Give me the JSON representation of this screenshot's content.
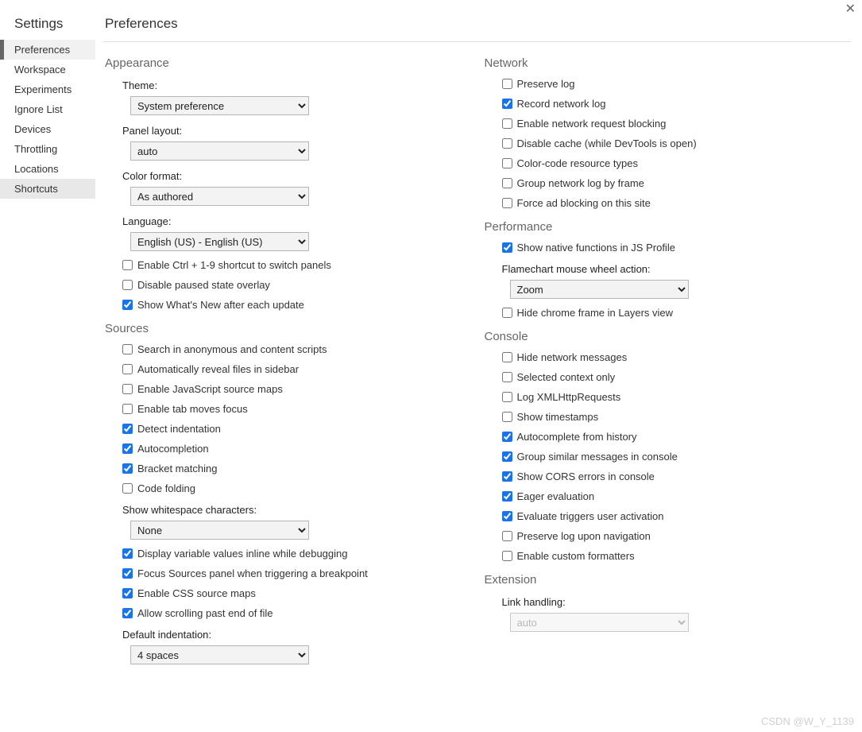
{
  "sidebar": {
    "title": "Settings",
    "items": [
      {
        "label": "Preferences",
        "active": true
      },
      {
        "label": "Workspace"
      },
      {
        "label": "Experiments"
      },
      {
        "label": "Ignore List"
      },
      {
        "label": "Devices"
      },
      {
        "label": "Throttling"
      },
      {
        "label": "Locations"
      },
      {
        "label": "Shortcuts",
        "hover": true
      }
    ]
  },
  "main": {
    "title": "Preferences",
    "close": "✕"
  },
  "appearance": {
    "heading": "Appearance",
    "theme_label": "Theme:",
    "theme_value": "System preference",
    "panel_label": "Panel layout:",
    "panel_value": "auto",
    "color_label": "Color format:",
    "color_value": "As authored",
    "lang_label": "Language:",
    "lang_value": "English (US) - English (US)",
    "ctrl_shortcut": "Enable Ctrl + 1-9 shortcut to switch panels",
    "disable_paused": "Disable paused state overlay",
    "show_whats_new": "Show What's New after each update"
  },
  "sources": {
    "heading": "Sources",
    "search_anon": "Search in anonymous and content scripts",
    "auto_reveal": "Automatically reveal files in sidebar",
    "js_maps": "Enable JavaScript source maps",
    "tab_focus": "Enable tab moves focus",
    "detect_indent": "Detect indentation",
    "autocomplete": "Autocompletion",
    "bracket": "Bracket matching",
    "code_fold": "Code folding",
    "whitespace_label": "Show whitespace characters:",
    "whitespace_value": "None",
    "display_vars": "Display variable values inline while debugging",
    "focus_sources": "Focus Sources panel when triggering a breakpoint",
    "css_maps": "Enable CSS source maps",
    "scroll_past": "Allow scrolling past end of file",
    "indent_label": "Default indentation:",
    "indent_value": "4 spaces"
  },
  "network": {
    "heading": "Network",
    "preserve": "Preserve log",
    "record": "Record network log",
    "blocking": "Enable network request blocking",
    "disable_cache": "Disable cache (while DevTools is open)",
    "color_code": "Color-code resource types",
    "group_frame": "Group network log by frame",
    "force_ad": "Force ad blocking on this site"
  },
  "performance": {
    "heading": "Performance",
    "native_fn": "Show native functions in JS Profile",
    "flame_label": "Flamechart mouse wheel action:",
    "flame_value": "Zoom",
    "hide_chrome": "Hide chrome frame in Layers view"
  },
  "console": {
    "heading": "Console",
    "hide_net": "Hide network messages",
    "sel_ctx": "Selected context only",
    "log_xhr": "Log XMLHttpRequests",
    "timestamps": "Show timestamps",
    "auto_hist": "Autocomplete from history",
    "group_sim": "Group similar messages in console",
    "cors": "Show CORS errors in console",
    "eager": "Eager evaluation",
    "eval_trig": "Evaluate triggers user activation",
    "preserve_nav": "Preserve log upon navigation",
    "custom_fmt": "Enable custom formatters"
  },
  "extension": {
    "heading": "Extension",
    "link_label": "Link handling:",
    "link_value": "auto"
  },
  "watermark": "CSDN @W_Y_1139"
}
